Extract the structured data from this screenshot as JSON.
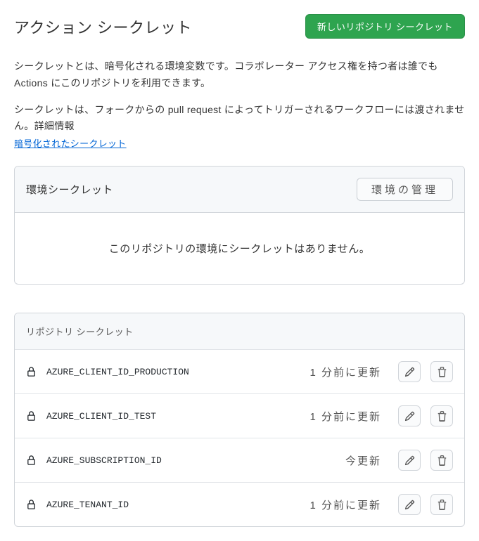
{
  "header": {
    "title": "アクション シークレット",
    "new_button": "新しいリポジトリ シークレット"
  },
  "description": {
    "p1": "シークレットとは、暗号化される環境変数です。コラボレーター アクセス権を持つ者は誰でも Actions にこのリポジトリを利用できます。",
    "p2": "シークレットは、フォークからの pull request によってトリガーされるワークフローには渡されません。詳細情報",
    "link": "暗号化されたシークレット"
  },
  "env_secrets": {
    "title": "環境シークレット",
    "manage_button": "環境の管理",
    "empty": "このリポジトリの環境にシークレットはありません。"
  },
  "repo_secrets": {
    "title": "リポジトリ シークレット",
    "items": [
      {
        "name": "AZURE_CLIENT_ID_PRODUCTION",
        "updated": "1 分前に更新"
      },
      {
        "name": "AZURE_CLIENT_ID_TEST",
        "updated": "1 分前に更新"
      },
      {
        "name": "AZURE_SUBSCRIPTION_ID",
        "updated": "今更新"
      },
      {
        "name": "AZURE_TENANT_ID",
        "updated": "1 分前に更新"
      }
    ]
  }
}
